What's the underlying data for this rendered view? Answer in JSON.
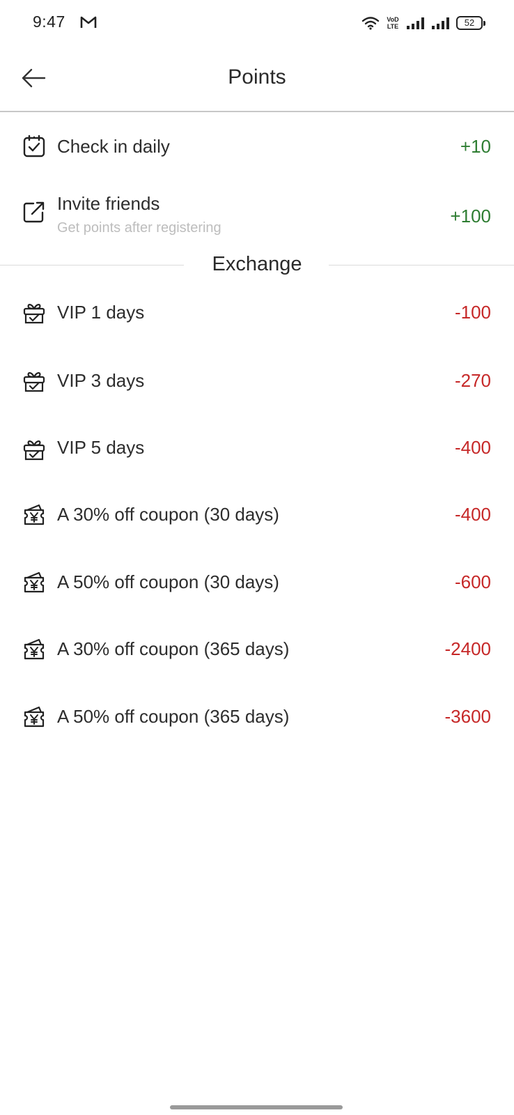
{
  "status_bar": {
    "time": "9:47",
    "notification_icon": "gmail-icon",
    "network_label": "VoLTE",
    "volte_top": "VoD",
    "volte_bottom": "LTE",
    "battery": "52"
  },
  "header": {
    "back_icon": "arrow-left-icon",
    "title": "Points"
  },
  "earn": [
    {
      "label": "Check in daily",
      "sublabel": "",
      "points": "+10",
      "icon": "calendar-check-icon"
    },
    {
      "label": "Invite friends",
      "sublabel": "Get points after registering",
      "points": "+100",
      "icon": "share-external-icon"
    }
  ],
  "exchange": {
    "title": "Exchange",
    "items": [
      {
        "label": "VIP 1 days",
        "points": "-100",
        "icon": "gift-box-icon"
      },
      {
        "label": "VIP 3 days",
        "points": "-270",
        "icon": "gift-box-icon"
      },
      {
        "label": "VIP 5 days",
        "points": "-400",
        "icon": "gift-box-icon"
      },
      {
        "label": "A 30% off coupon (30 days)",
        "points": "-400",
        "icon": "coupon-yen-icon"
      },
      {
        "label": "A 50% off coupon (30 days)",
        "points": "-600",
        "icon": "coupon-yen-icon"
      },
      {
        "label": "A 30% off coupon (365 days)",
        "points": "-2400",
        "icon": "coupon-yen-icon"
      },
      {
        "label": "A 50% off coupon (365 days)",
        "points": "-3600",
        "icon": "coupon-yen-icon"
      }
    ]
  },
  "colors": {
    "positive": "#2e7d32",
    "negative": "#c62828",
    "text": "#2d2d2d",
    "subtext": "#bdbdbd",
    "divider": "#c7c7c7"
  }
}
